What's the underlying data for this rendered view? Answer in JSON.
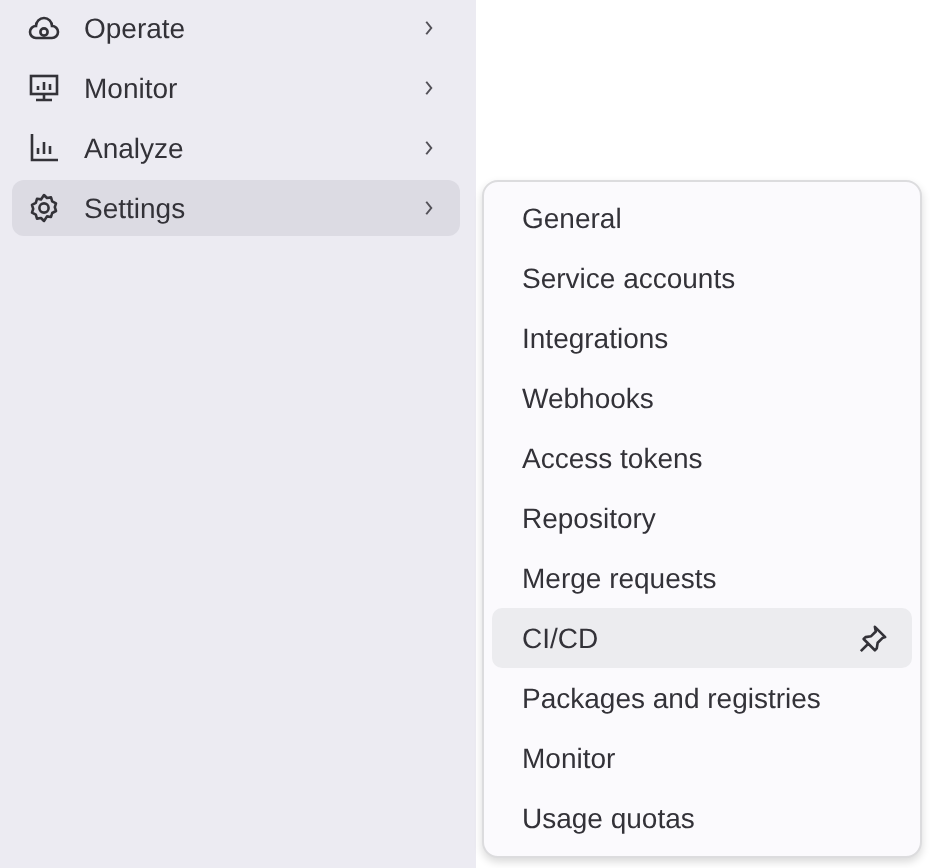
{
  "sidebar": {
    "items": [
      {
        "label": "Operate",
        "kind": "operate",
        "selected": false
      },
      {
        "label": "Monitor",
        "kind": "monitor",
        "selected": false
      },
      {
        "label": "Analyze",
        "kind": "analyze",
        "selected": false
      },
      {
        "label": "Settings",
        "kind": "settings",
        "selected": true
      }
    ]
  },
  "flyout": {
    "items": [
      {
        "label": "General",
        "hovered": false
      },
      {
        "label": "Service accounts",
        "hovered": false
      },
      {
        "label": "Integrations",
        "hovered": false
      },
      {
        "label": "Webhooks",
        "hovered": false
      },
      {
        "label": "Access tokens",
        "hovered": false
      },
      {
        "label": "Repository",
        "hovered": false
      },
      {
        "label": "Merge requests",
        "hovered": false
      },
      {
        "label": "CI/CD",
        "hovered": true
      },
      {
        "label": "Packages and registries",
        "hovered": false
      },
      {
        "label": "Monitor",
        "hovered": false
      },
      {
        "label": "Usage quotas",
        "hovered": false
      }
    ]
  }
}
